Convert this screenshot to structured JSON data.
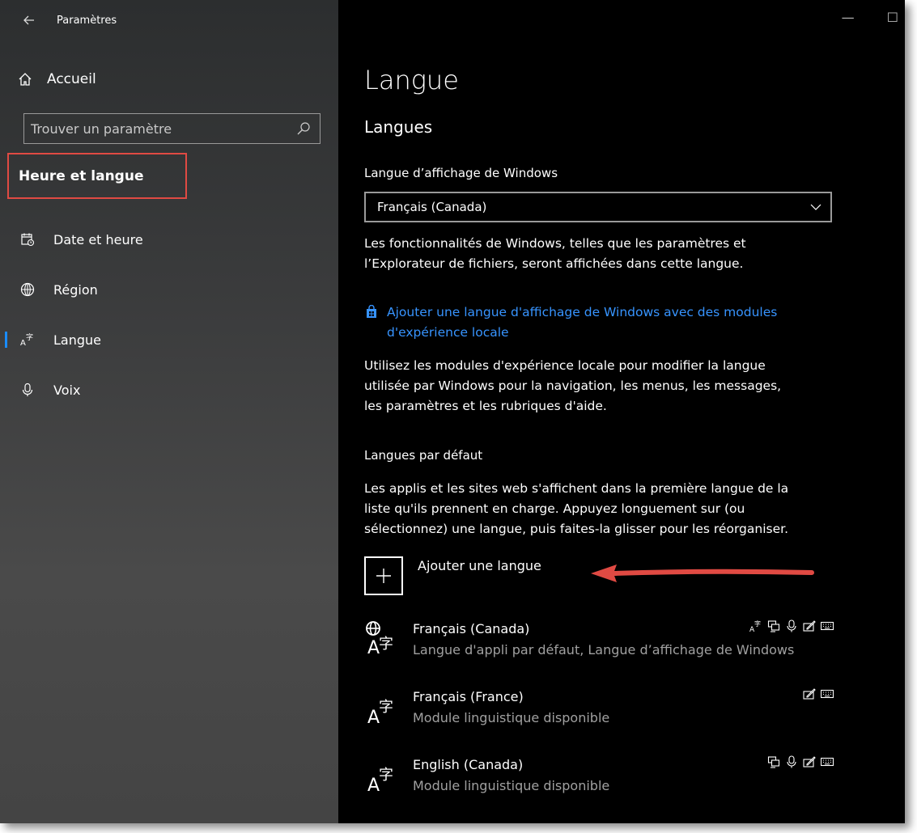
{
  "window": {
    "title": "Paramètres",
    "minimize": "—",
    "maximize": "☐"
  },
  "sidebar": {
    "home_label": "Accueil",
    "search_placeholder": "Trouver un paramètre",
    "section_title": "Heure et langue",
    "items": [
      {
        "label": "Date et heure",
        "icon": "calendar-clock-icon"
      },
      {
        "label": "Région",
        "icon": "globe-icon"
      },
      {
        "label": "Langue",
        "icon": "language-icon",
        "active": true
      },
      {
        "label": "Voix",
        "icon": "microphone-icon"
      }
    ]
  },
  "main": {
    "page_title": "Langue",
    "section_title": "Langues",
    "display_lang_label": "Langue d’affichage de Windows",
    "display_lang_value": "Français (Canada)",
    "display_lang_desc_1": "Les fonctionnalités de Windows, telles que les paramètres et",
    "display_lang_desc_2": "l’Explorateur de fichiers, seront affichées dans cette langue.",
    "store_link_1": "Ajouter une langue d'affichage de Windows avec des modules",
    "store_link_2": "d'expérience locale",
    "lxp_desc_1": "Utilisez les modules d'expérience locale pour modifier la langue",
    "lxp_desc_2": "utilisée par Windows pour la navigation, les menus, les messages,",
    "lxp_desc_3": "les paramètres et les rubriques d'aide.",
    "preferred_title": "Langues par défaut",
    "preferred_desc_1": "Les applis et les sites web s'affichent dans la première langue de la",
    "preferred_desc_2": "liste qu'ils prennent en charge. Appuyez longuement sur (ou",
    "preferred_desc_3": "sélectionnez) une langue, puis faites-la glisser pour les réorganiser.",
    "add_language": "Ajouter une langue",
    "languages": [
      {
        "name": "Français (Canada)",
        "subtitle": "Langue d'appli par défaut, Langue d’affichage de Windows",
        "features": [
          "display-language-icon",
          "text-to-speech-icon",
          "speech-recognition-icon",
          "handwriting-icon",
          "keyboard-icon"
        ]
      },
      {
        "name": "Français (France)",
        "subtitle": "Module linguistique disponible",
        "features": [
          "handwriting-icon",
          "keyboard-icon"
        ]
      },
      {
        "name": "English (Canada)",
        "subtitle": "Module linguistique disponible",
        "features": [
          "text-to-speech-icon",
          "speech-recognition-icon",
          "handwriting-icon",
          "keyboard-icon"
        ]
      }
    ]
  },
  "annotation": {
    "highlight_color": "#e04a43",
    "arrow_color": "#e04a43"
  }
}
